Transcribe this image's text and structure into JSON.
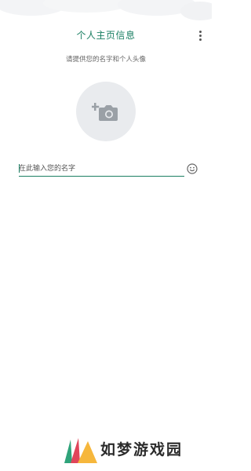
{
  "header": {
    "title": "个人主页信息"
  },
  "subtitle": "请提供您的名字和个人头像",
  "name_input": {
    "placeholder": "在此输入您的名字",
    "value": ""
  },
  "icons": {
    "overflow": "more-vertical-icon",
    "avatar": "add-photo-icon",
    "emoji": "emoji-icon",
    "watermark_logo": "watermark-logo-icon"
  },
  "colors": {
    "accent": "#1b7f63",
    "avatar_bg": "#e9ebee",
    "icon": "#9aa0a6"
  },
  "watermark": {
    "text": "如梦游戏园"
  }
}
